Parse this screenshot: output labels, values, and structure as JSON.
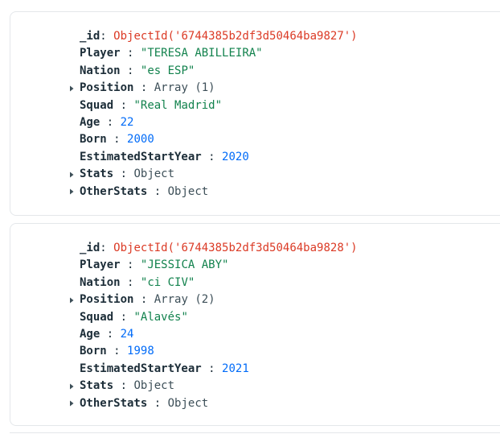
{
  "documents": [
    {
      "id_label": "_id",
      "id_value": "ObjectId('6744385b2df3d50464ba9827')",
      "player_label": "Player",
      "player_value": "\"TERESA ABILLEIRA\"",
      "nation_label": "Nation",
      "nation_value": "\"es ESP\"",
      "position_label": "Position",
      "position_value": "Array (1)",
      "squad_label": "Squad",
      "squad_value": "\"Real Madrid\"",
      "age_label": "Age",
      "age_value": "22",
      "born_label": "Born",
      "born_value": "2000",
      "est_label": "EstimatedStartYear",
      "est_value": "2020",
      "stats_label": "Stats",
      "stats_value": "Object",
      "other_label": "OtherStats",
      "other_value": "Object"
    },
    {
      "id_label": "_id",
      "id_value": "ObjectId('6744385b2df3d50464ba9828')",
      "player_label": "Player",
      "player_value": "\"JESSICA ABY\"",
      "nation_label": "Nation",
      "nation_value": "\"ci CIV\"",
      "position_label": "Position",
      "position_value": "Array (2)",
      "squad_label": "Squad",
      "squad_value": "\"Alavés\"",
      "age_label": "Age",
      "age_value": "24",
      "born_label": "Born",
      "born_value": "1998",
      "est_label": "EstimatedStartYear",
      "est_value": "2021",
      "stats_label": "Stats",
      "stats_value": "Object",
      "other_label": "OtherStats",
      "other_value": "Object"
    }
  ],
  "separator": ":",
  "icons": {
    "expand": "caret-right-icon"
  },
  "colors": {
    "objectid": "#db3a25",
    "string": "#12824d",
    "number": "#016bf8",
    "key": "#1c2d38"
  }
}
